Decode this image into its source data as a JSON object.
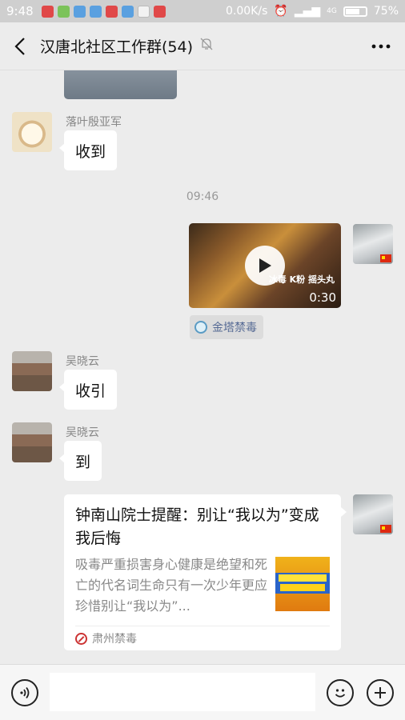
{
  "status_bar": {
    "time": "9:48",
    "network_speed": "0.00K/s",
    "network_type": "4G",
    "battery": "75%",
    "battery_level": 0.75
  },
  "header": {
    "title": "汉唐北社区工作群(54)",
    "back_icon": "chevron-left-icon",
    "mute_icon": "bell-off-icon",
    "more_icon": "more-dots-icon"
  },
  "messages": [
    {
      "type": "text",
      "sender": "落叶殷亚军",
      "text": "收到"
    },
    {
      "type": "timestamp",
      "text": "09:46"
    },
    {
      "type": "video",
      "self": true,
      "caption": "冰毒 K粉 摇头丸",
      "duration": "0:30",
      "source": "金塔禁毒"
    },
    {
      "type": "text",
      "sender": "吴晓云",
      "text": "收引"
    },
    {
      "type": "text",
      "sender": "吴晓云",
      "text": "到"
    },
    {
      "type": "article",
      "self": true,
      "title": "钟南山院士提醒：别让“我以为”变成我后悔",
      "description": "吸毒严重损害身心健康是绝望和死亡的代名词生命只有一次少年更应珍惜别让“我以为”...",
      "source": "肃州禁毒"
    }
  ],
  "input_bar": {
    "voice_icon": "voice-icon",
    "emoji_icon": "emoji-icon",
    "plus_icon": "plus-icon",
    "placeholder": ""
  },
  "colors": {
    "background": "#ececec",
    "bubble": "#ffffff",
    "link": "#576b95"
  }
}
